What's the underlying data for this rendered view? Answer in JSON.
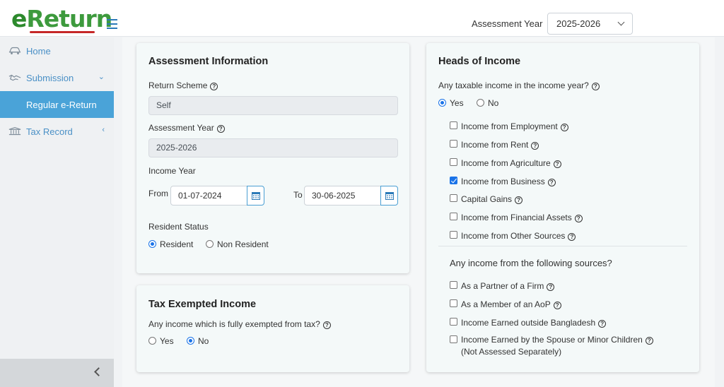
{
  "header": {
    "logo_text_e": "e",
    "logo_text_rest": "Return",
    "assessment_year_label": "Assessment Year",
    "assessment_year_value": "2025-2026"
  },
  "sidebar": {
    "items": [
      {
        "label": "Home",
        "icon": "car-icon"
      },
      {
        "label": "Submission",
        "icon": "handshake-icon"
      },
      {
        "label": "Regular e-Return"
      },
      {
        "label": "Tax Record",
        "icon": "bank-icon"
      }
    ]
  },
  "assessment_info": {
    "title": "Assessment Information",
    "return_scheme_label": "Return Scheme",
    "return_scheme_value": "Self",
    "assessment_year_label": "Assessment Year",
    "assessment_year_value": "2025-2026",
    "income_year_label": "Income Year",
    "from_label": "From",
    "from_value": "01-07-2024",
    "to_label": "To",
    "to_value": "30-06-2025",
    "resident_status_label": "Resident Status",
    "resident_option": "Resident",
    "non_resident_option": "Non Resident"
  },
  "tax_exempted": {
    "title": "Tax Exempted Income",
    "question": "Any income which is fully exempted from tax?",
    "yes_label": "Yes",
    "no_label": "No"
  },
  "heads_of_income": {
    "title": "Heads of Income",
    "question": "Any taxable income in the income year?",
    "yes_label": "Yes",
    "no_label": "No",
    "heads": [
      {
        "label": "Income from Employment",
        "checked": false
      },
      {
        "label": "Income from Rent",
        "checked": false
      },
      {
        "label": "Income from Agriculture",
        "checked": false
      },
      {
        "label": "Income from Business",
        "checked": true
      },
      {
        "label": "Capital Gains",
        "checked": false
      },
      {
        "label": "Income from Financial Assets",
        "checked": false
      },
      {
        "label": "Income from Other Sources",
        "checked": false
      }
    ],
    "other_sources_question": "Any income from the following sources?",
    "other_sources": [
      {
        "label": "As a Partner of a Firm",
        "checked": false
      },
      {
        "label": "As a Member of an AoP",
        "checked": false
      },
      {
        "label": "Income Earned outside Bangladesh",
        "checked": false
      },
      {
        "label": "Income Earned by the Spouse or Minor Children",
        "label_line2": "(Not Assessed Separately)",
        "checked": false
      }
    ]
  },
  "colors": {
    "brand_green": "#2d8a2d",
    "accent_blue": "#4aa3d8",
    "link_blue": "#4a90c6"
  }
}
